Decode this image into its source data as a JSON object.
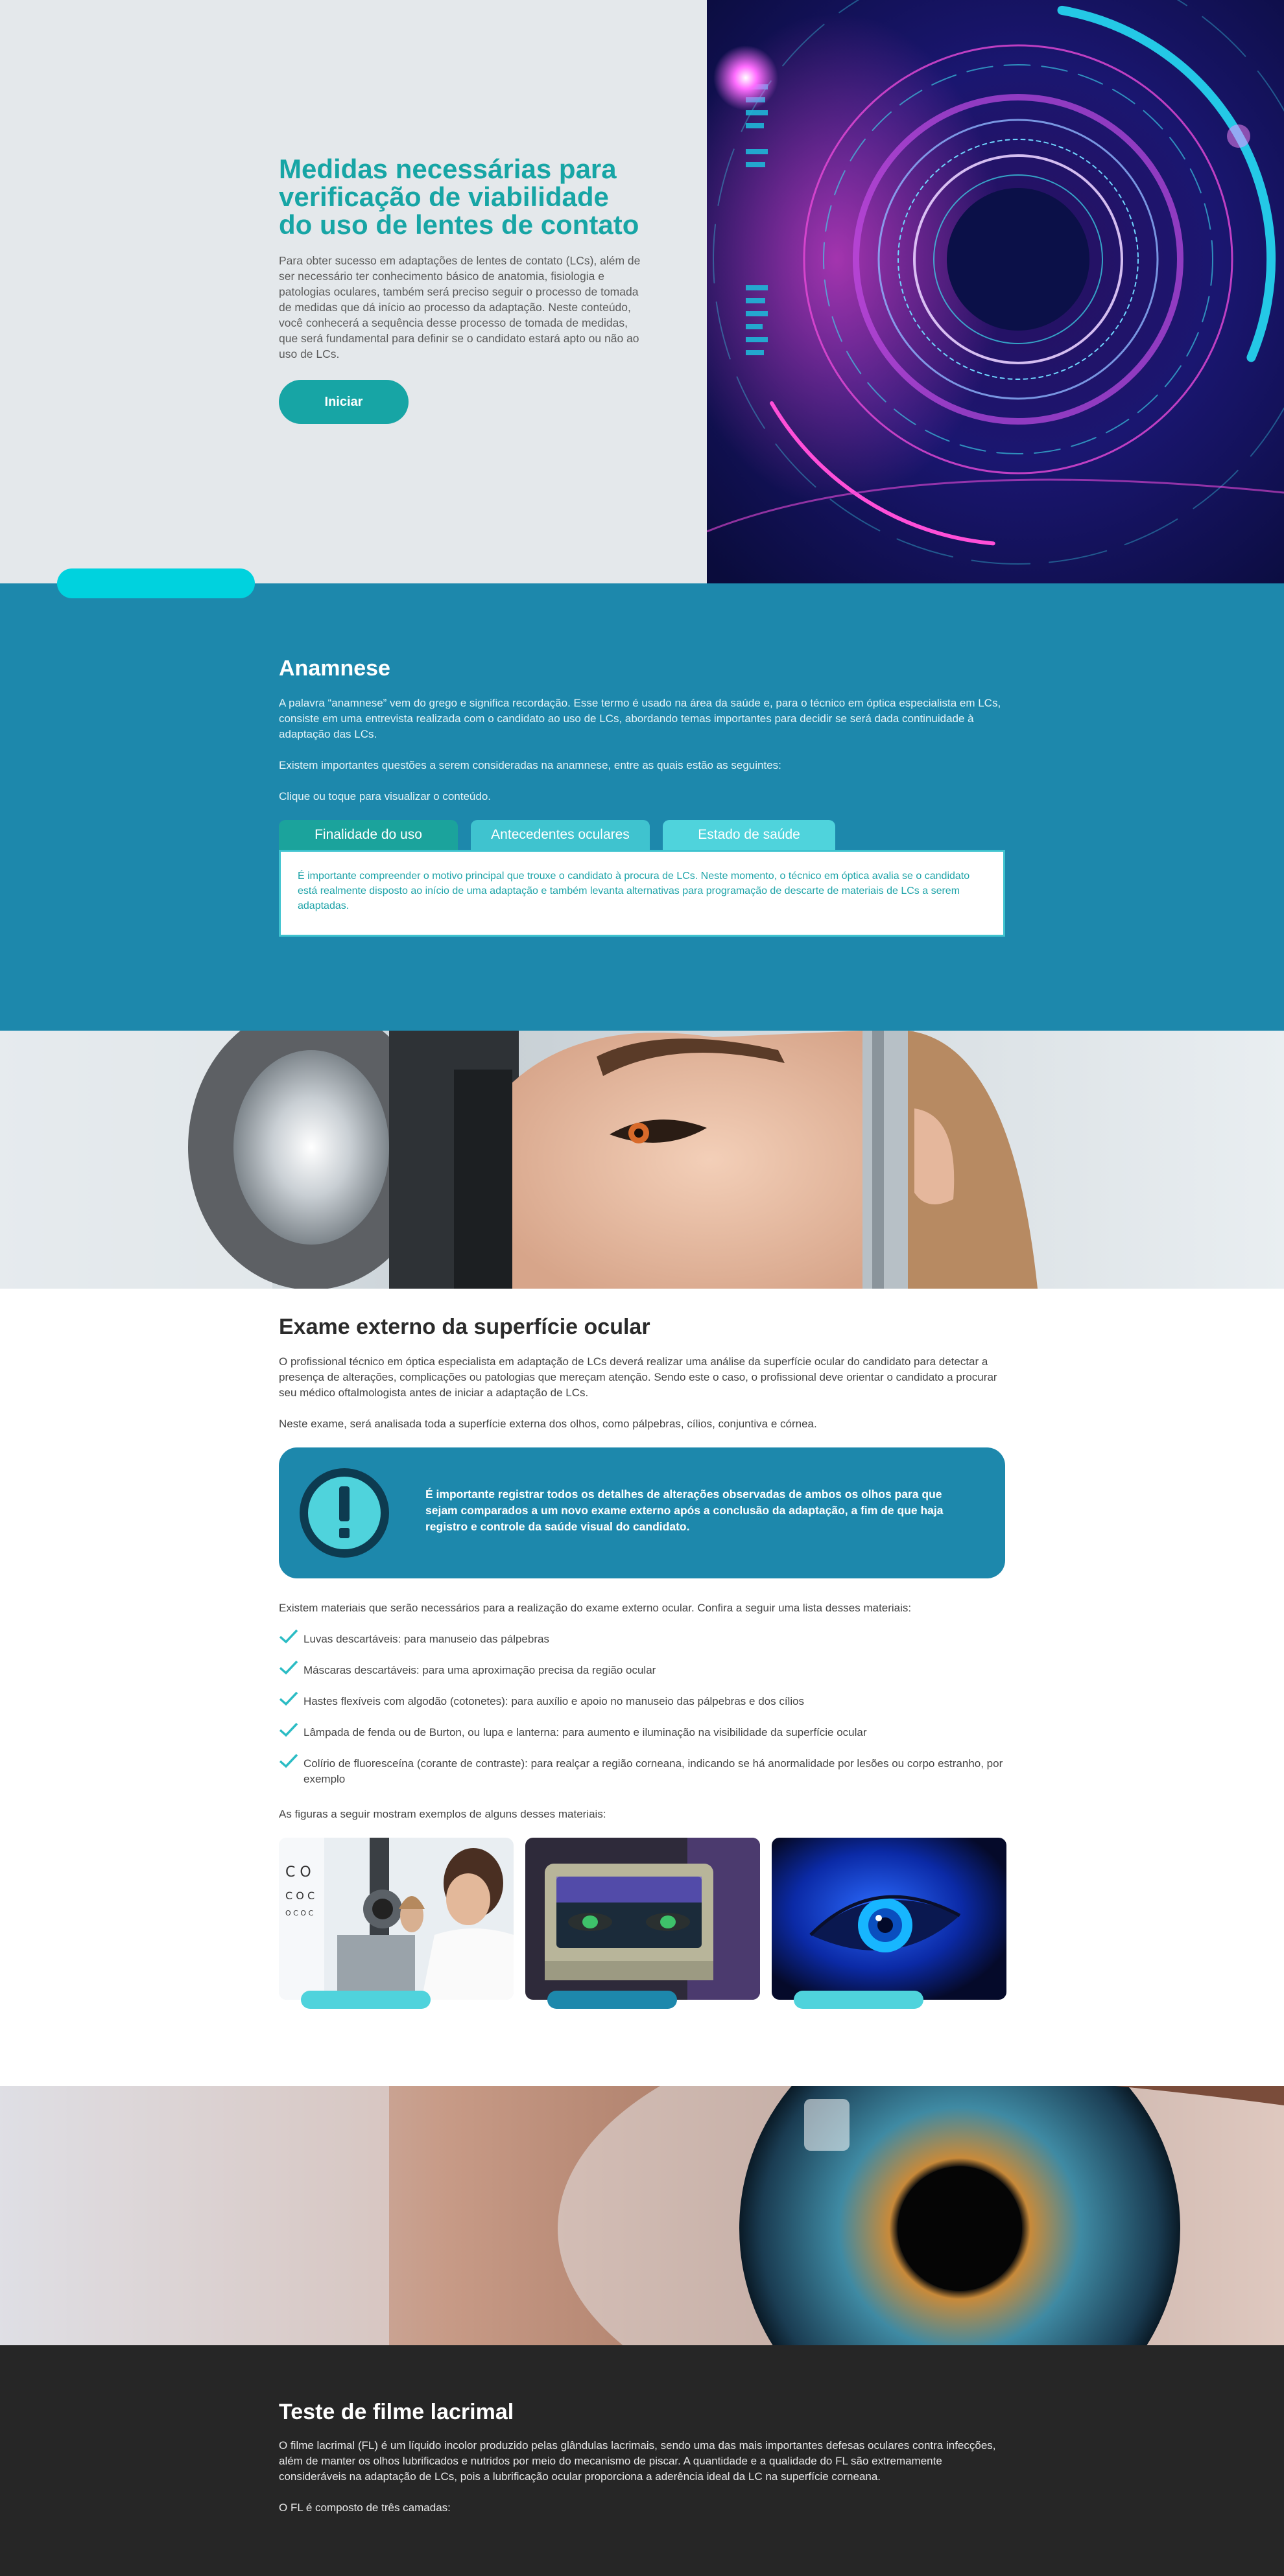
{
  "hero": {
    "title": "Medidas necessárias para verificação de viabilidade do uso de lentes de contato",
    "description": "Para obter sucesso em adaptações de lentes de contato (LCs), além de ser necessário ter conhecimento básico de anatomia, fisiologia e patologias oculares, também será preciso seguir o processo de tomada de medidas que dá início ao processo da adaptação. Neste conteúdo, você conhecerá a sequência desse processo de tomada de medidas, que será fundamental para definir se o candidato estará apto ou não ao uso de LCs.",
    "start_label": "Iniciar"
  },
  "anamnese": {
    "title": "Anamnese",
    "p1": "A palavra “anamnese” vem do grego e significa recordação. Esse termo é usado na área da saúde e, para o técnico em óptica especialista em LCs, consiste em uma entrevista realizada com o candidato ao uso de LCs, abordando temas importantes para decidir se será dada continuidade à adaptação das LCs.",
    "p2": "Existem importantes questões a serem consideradas na anamnese, entre as quais estão as seguintes:",
    "p3": "Clique ou toque para visualizar o conteúdo.",
    "tabs": [
      "Finalidade do uso",
      "Antecedentes oculares",
      "Estado de saúde"
    ],
    "panel_text": "É importante compreender o motivo principal que trouxe o candidato à procura de LCs. Neste momento, o técnico em óptica avalia se o candidato está realmente disposto ao início de uma adaptação e também levanta alternativas para programação de descarte de materiais de LCs a serem adaptadas."
  },
  "exame": {
    "title": "Exame externo da superfície ocular",
    "p1": "O profissional técnico em óptica especialista em adaptação de LCs deverá realizar uma análise da superfície ocular do candidato para detectar a presença de alterações, complicações ou patologias que mereçam atenção. Sendo este o caso, o profissional deve orientar o candidato a procurar seu médico oftalmologista antes de iniciar a adaptação de LCs.",
    "p2": "Neste exame, será analisada toda a superfície externa dos olhos, como pálpebras, cílios, conjuntiva e córnea.",
    "alert_text": "É importante registrar todos os detalhes de alterações observadas de ambos os olhos para que sejam comparados a um novo exame externo após a conclusão da adaptação, a fim de que haja registro e controle da saúde visual do candidato.",
    "p3": "Existem materiais que serão necessários para a realização do exame externo ocular. Confira a seguir uma lista desses materiais:",
    "materials": [
      "Luvas descartáveis: para manuseio das pálpebras",
      "Máscaras descartáveis: para uma aproximação precisa da região ocular",
      "Hastes flexíveis com algodão (cotonetes): para auxílio e apoio no manuseio das pálpebras e dos cílios",
      "Lâmpada de fenda ou de Burton, ou lupa e lanterna: para aumento e iluminação na visibilidade da superfície ocular",
      "Colírio de fluoresceína (corante de contraste): para realçar a região corneana, indicando se há anormalidade por lesões ou corpo estranho, por exemplo"
    ],
    "p4": "As figuras a seguir mostram exemplos de alguns desses materiais:",
    "thumb_bar_colors": [
      "#4fd3dc",
      "#1d88ac",
      "#4fd3dc"
    ]
  },
  "lacrimal": {
    "title": "Teste de filme lacrimal",
    "p1": "O filme lacrimal (FL) é um líquido incolor produzido pelas glândulas lacrimais, sendo uma das mais importantes defesas oculares contra infecções, além de manter os olhos lubrificados e nutridos por meio do mecanismo de piscar. A quantidade e a qualidade do FL são extremamente consideráveis na adaptação de LCs, pois a lubrificação ocular proporciona a aderência ideal da LC na superfície corneana.",
    "p2": "O FL é composto de três camadas:"
  },
  "colors": {
    "accent_teal": "#17a5a5",
    "section_blue": "#1d88ac",
    "cyan_pill": "#00d2de",
    "dark_section": "#262626"
  }
}
